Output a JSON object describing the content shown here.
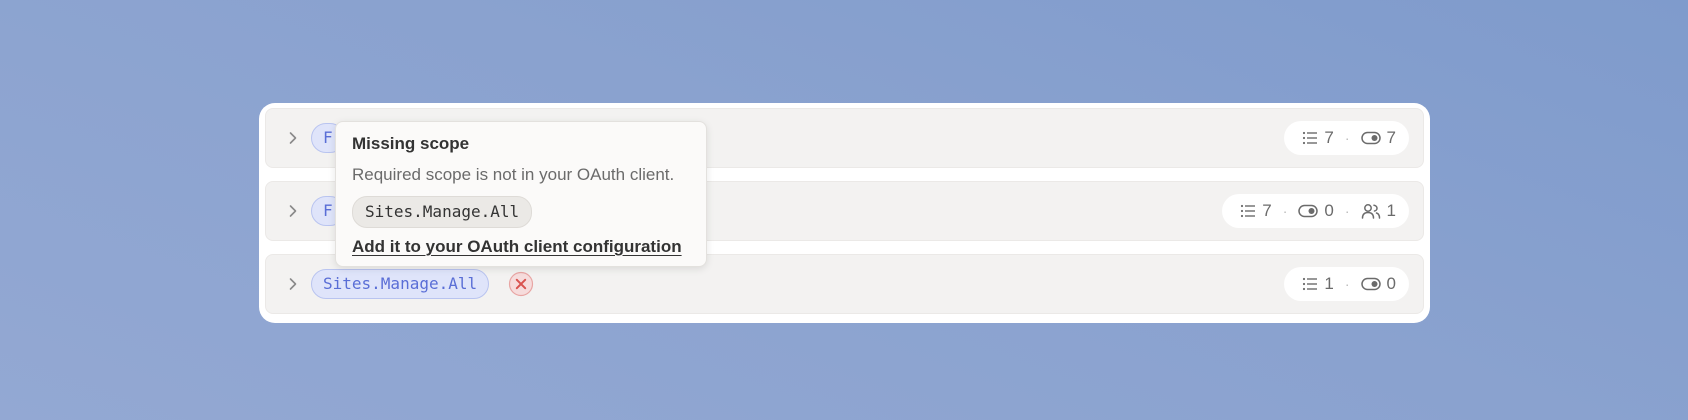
{
  "rows": [
    {
      "scope_label": "F",
      "stats": {
        "list_count": "7",
        "toggle_count": "7"
      }
    },
    {
      "scope_label": "F",
      "stats": {
        "list_count": "7",
        "toggle_count": "0",
        "users_count": "1"
      }
    },
    {
      "scope_label": "Sites.Manage.All",
      "error": true,
      "stats": {
        "list_count": "1",
        "toggle_count": "0"
      }
    }
  ],
  "tooltip": {
    "title": "Missing scope",
    "description": "Required scope is not in your OAuth client.",
    "scope_code": "Sites.Manage.All",
    "link_label": "Add it to your OAuth client configuration"
  },
  "stat_separator": "·",
  "icons": {
    "expand": "chevron-right-icon",
    "list": "list-icon",
    "toggle": "toggle-icon",
    "users": "users-icon",
    "error": "x-circle-icon"
  },
  "colors": {
    "scope_chip_bg": "#dfe4fa",
    "scope_chip_text": "#5a6ed6",
    "error_red": "#d9534f",
    "background": "#8aa2cf"
  }
}
